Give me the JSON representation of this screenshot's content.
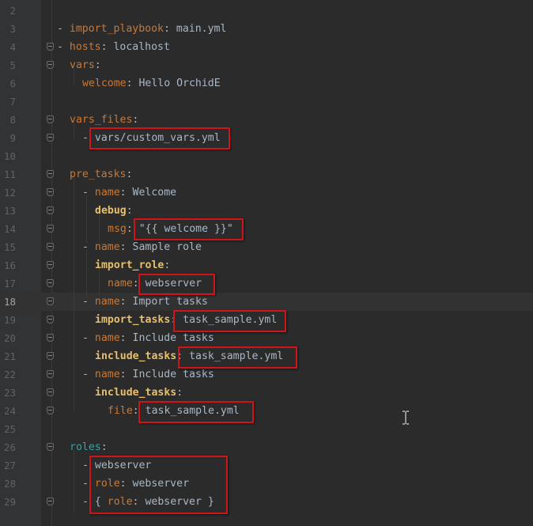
{
  "editor": {
    "language": "YAML",
    "current_line": "18",
    "lines": [
      {
        "num": "2",
        "indent": 0,
        "tokens": []
      },
      {
        "num": "3",
        "indent": 72,
        "tokens": [
          {
            "t": "- ",
            "c": "dash"
          },
          {
            "t": "import_playbook",
            "c": "key"
          },
          {
            "t": ": ",
            "c": "val"
          },
          {
            "t": "main.yml",
            "c": "val"
          }
        ]
      },
      {
        "num": "4",
        "indent": 72,
        "fold": true,
        "tokens": [
          {
            "t": "- ",
            "c": "dash"
          },
          {
            "t": "hosts",
            "c": "key"
          },
          {
            "t": ": ",
            "c": "val"
          },
          {
            "t": "localhost",
            "c": "val"
          }
        ]
      },
      {
        "num": "5",
        "indent": 88,
        "fold": true,
        "tokens": [
          {
            "t": "vars",
            "c": "key"
          },
          {
            "t": ":",
            "c": "val"
          }
        ]
      },
      {
        "num": "6",
        "indent": 104,
        "tokens": [
          {
            "t": "welcome",
            "c": "key"
          },
          {
            "t": ": ",
            "c": "val"
          },
          {
            "t": "Hello OrchidE",
            "c": "val"
          }
        ]
      },
      {
        "num": "7",
        "indent": 0,
        "tokens": []
      },
      {
        "num": "8",
        "indent": 88,
        "fold": true,
        "tokens": [
          {
            "t": "vars_files",
            "c": "key"
          },
          {
            "t": ":",
            "c": "val"
          }
        ]
      },
      {
        "num": "9",
        "indent": 104,
        "fold": true,
        "tokens": [
          {
            "t": "- ",
            "c": "dash"
          },
          {
            "t": "vars/custom_vars.yml",
            "c": "val"
          }
        ]
      },
      {
        "num": "10",
        "indent": 0,
        "tokens": []
      },
      {
        "num": "11",
        "indent": 88,
        "fold": true,
        "tokens": [
          {
            "t": "pre_tasks",
            "c": "key"
          },
          {
            "t": ":",
            "c": "val"
          }
        ]
      },
      {
        "num": "12",
        "indent": 104,
        "fold": true,
        "tokens": [
          {
            "t": "- ",
            "c": "dash"
          },
          {
            "t": "name",
            "c": "key"
          },
          {
            "t": ": ",
            "c": "val"
          },
          {
            "t": "Welcome",
            "c": "val"
          }
        ]
      },
      {
        "num": "13",
        "indent": 120,
        "fold": true,
        "tokens": [
          {
            "t": "debug",
            "c": "key bold"
          },
          {
            "t": ":",
            "c": "val"
          }
        ]
      },
      {
        "num": "14",
        "indent": 136,
        "fold": true,
        "tokens": [
          {
            "t": "msg",
            "c": "key"
          },
          {
            "t": ": ",
            "c": "val"
          },
          {
            "t": "\"{{ welcome }}\"",
            "c": "str"
          }
        ]
      },
      {
        "num": "15",
        "indent": 104,
        "fold": true,
        "tokens": [
          {
            "t": "- ",
            "c": "dash"
          },
          {
            "t": "name",
            "c": "key"
          },
          {
            "t": ": ",
            "c": "val"
          },
          {
            "t": "Sample role",
            "c": "val"
          }
        ]
      },
      {
        "num": "16",
        "indent": 120,
        "fold": true,
        "tokens": [
          {
            "t": "import_role",
            "c": "key bold"
          },
          {
            "t": ":",
            "c": "val"
          }
        ]
      },
      {
        "num": "17",
        "indent": 136,
        "fold": true,
        "tokens": [
          {
            "t": "name",
            "c": "key"
          },
          {
            "t": ": ",
            "c": "val"
          },
          {
            "t": "webserver",
            "c": "val"
          }
        ]
      },
      {
        "num": "18",
        "indent": 104,
        "fold": true,
        "tokens": [
          {
            "t": "- ",
            "c": "dash"
          },
          {
            "t": "name",
            "c": "key"
          },
          {
            "t": ": ",
            "c": "val"
          },
          {
            "t": "Import tasks",
            "c": "val"
          }
        ]
      },
      {
        "num": "19",
        "indent": 120,
        "fold": true,
        "tokens": [
          {
            "t": "import_tasks",
            "c": "key bold"
          },
          {
            "t": ": ",
            "c": "val"
          },
          {
            "t": "task_sample.yml",
            "c": "val"
          }
        ]
      },
      {
        "num": "20",
        "indent": 104,
        "fold": true,
        "tokens": [
          {
            "t": "- ",
            "c": "dash"
          },
          {
            "t": "name",
            "c": "key"
          },
          {
            "t": ": ",
            "c": "val"
          },
          {
            "t": "Include tasks",
            "c": "val"
          }
        ]
      },
      {
        "num": "21",
        "indent": 120,
        "fold": true,
        "tokens": [
          {
            "t": "include_tasks",
            "c": "key bold"
          },
          {
            "t": ": ",
            "c": "val"
          },
          {
            "t": "task_sample.yml",
            "c": "val"
          }
        ]
      },
      {
        "num": "22",
        "indent": 104,
        "fold": true,
        "tokens": [
          {
            "t": "- ",
            "c": "dash"
          },
          {
            "t": "name",
            "c": "key"
          },
          {
            "t": ": ",
            "c": "val"
          },
          {
            "t": "Include tasks",
            "c": "val"
          }
        ]
      },
      {
        "num": "23",
        "indent": 120,
        "fold": true,
        "tokens": [
          {
            "t": "include_tasks",
            "c": "key bold"
          },
          {
            "t": ":",
            "c": "val"
          }
        ]
      },
      {
        "num": "24",
        "indent": 136,
        "fold": true,
        "tokens": [
          {
            "t": "file",
            "c": "key"
          },
          {
            "t": ": ",
            "c": "val"
          },
          {
            "t": "task_sample.yml",
            "c": "val"
          }
        ]
      },
      {
        "num": "25",
        "indent": 0,
        "tokens": []
      },
      {
        "num": "26",
        "indent": 88,
        "fold": true,
        "tokens": [
          {
            "t": "roles",
            "c": "key teal"
          },
          {
            "t": ":",
            "c": "val"
          }
        ]
      },
      {
        "num": "27",
        "indent": 104,
        "tokens": [
          {
            "t": "- ",
            "c": "dash"
          },
          {
            "t": "webserver",
            "c": "val"
          }
        ]
      },
      {
        "num": "28",
        "indent": 104,
        "tokens": [
          {
            "t": "- ",
            "c": "dash"
          },
          {
            "t": "role",
            "c": "key"
          },
          {
            "t": ": ",
            "c": "val"
          },
          {
            "t": "webserver",
            "c": "val"
          }
        ]
      },
      {
        "num": "29",
        "indent": 104,
        "fold": true,
        "tokens": [
          {
            "t": "- ",
            "c": "dash"
          },
          {
            "t": "{ ",
            "c": "val"
          },
          {
            "t": "role",
            "c": "key"
          },
          {
            "t": ": ",
            "c": "val"
          },
          {
            "t": "webserver }",
            "c": "val"
          }
        ]
      }
    ]
  },
  "highlight_color": "#d0141a"
}
